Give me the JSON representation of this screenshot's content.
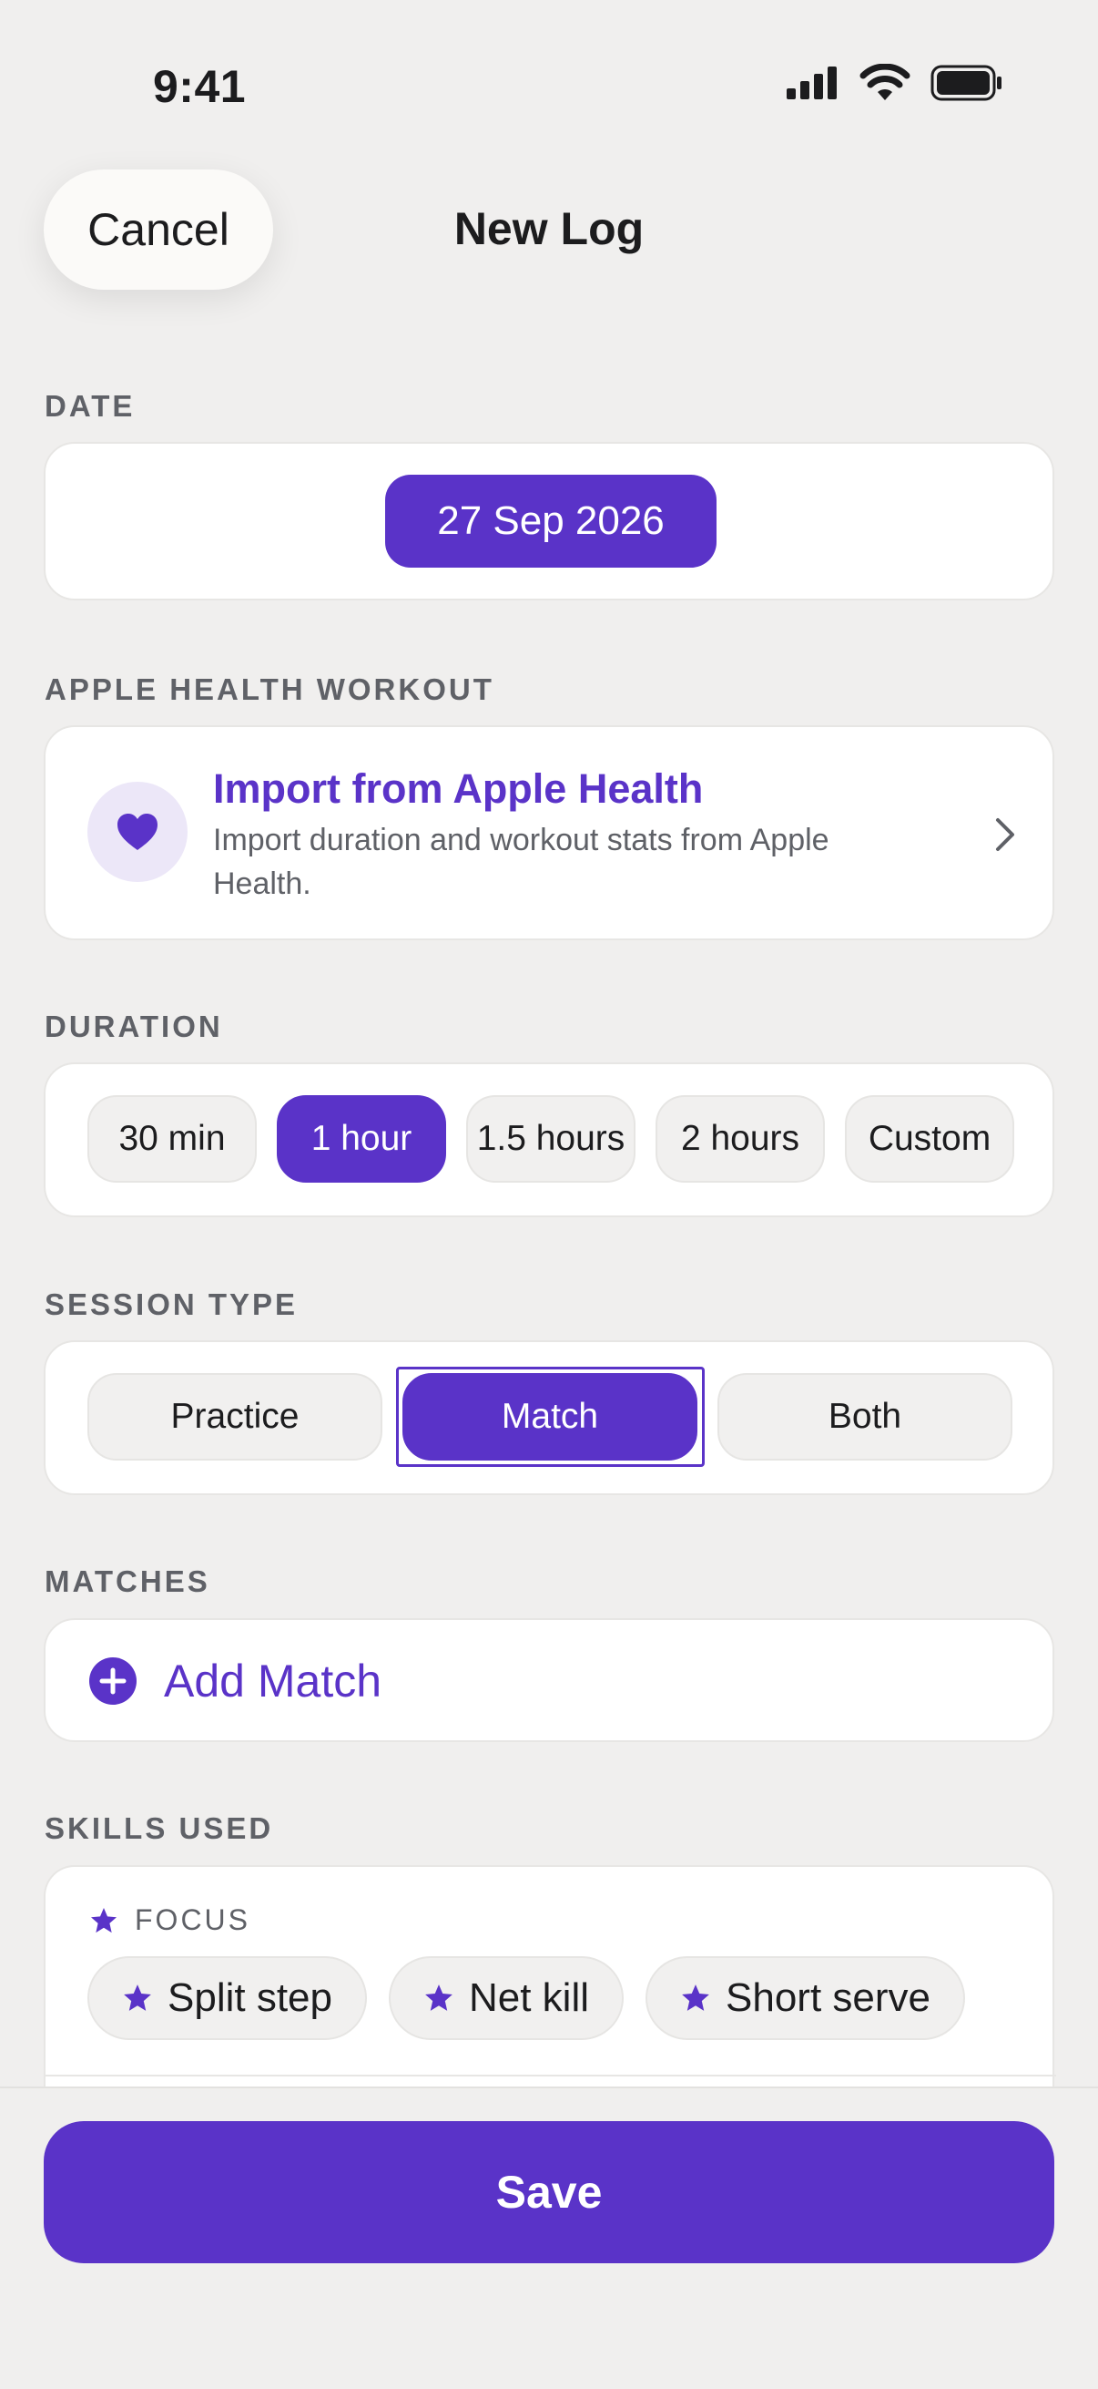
{
  "status_bar": {
    "time": "9:41"
  },
  "nav": {
    "cancel_label": "Cancel",
    "title": "New Log"
  },
  "date": {
    "section_label": "DATE",
    "value": "27 Sep 2026"
  },
  "apple_health": {
    "section_label": "APPLE HEALTH WORKOUT",
    "title": "Import from Apple Health",
    "subtitle": "Import duration and workout stats from Apple Health."
  },
  "duration": {
    "section_label": "DURATION",
    "options": [
      "30 min",
      "1 hour",
      "1.5 hours",
      "2 hours",
      "Custom"
    ],
    "selected": "1 hour"
  },
  "session_type": {
    "section_label": "SESSION TYPE",
    "options": [
      "Practice",
      "Match",
      "Both"
    ],
    "selected": "Match"
  },
  "matches": {
    "section_label": "MATCHES",
    "add_label": "Add Match"
  },
  "skills": {
    "section_label": "SKILLS USED",
    "focus_label": "FOCUS",
    "focus_items": [
      "Split step",
      "Net kill",
      "Short serve"
    ]
  },
  "save_label": "Save",
  "colors": {
    "accent": "#5A33C8",
    "background": "#F0EFEE",
    "card": "#FFFFFF"
  }
}
